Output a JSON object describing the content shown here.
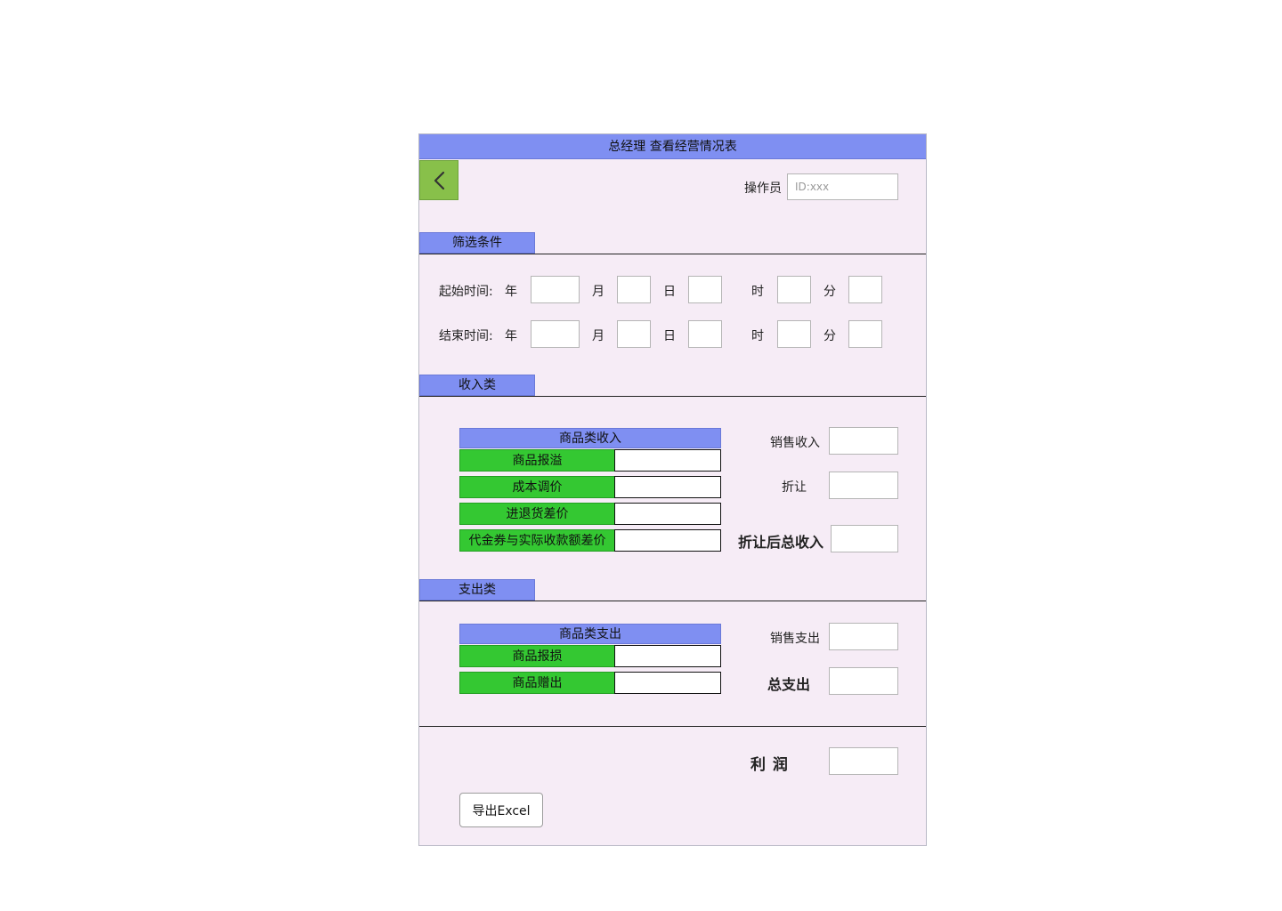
{
  "header": {
    "title": "总经理 查看经营情况表"
  },
  "operator": {
    "label": "操作员",
    "placeholder": "ID:xxx"
  },
  "filter": {
    "section_label": "筛选条件",
    "start_label": "起始时间:",
    "end_label": "结束时间:",
    "units": {
      "year": "年",
      "month": "月",
      "day": "日",
      "hour": "时",
      "minute": "分"
    }
  },
  "income": {
    "section_label": "收入类",
    "group_title": "商品类收入",
    "rows": [
      "商品报溢",
      "成本调价",
      "进退货差价",
      "代金券与实际收款额差价"
    ],
    "sales_income_label": "销售收入",
    "discount_label": "折让",
    "total_after_discount_label": "折让后总收入"
  },
  "expense": {
    "section_label": "支出类",
    "group_title": "商品类支出",
    "rows": [
      "商品报损",
      "商品赠出"
    ],
    "sales_expense_label": "销售支出",
    "total_expense_label": "总支出"
  },
  "profit": {
    "label": "利 润"
  },
  "actions": {
    "export_label": "导出Excel"
  },
  "colors": {
    "accent": "#7f8ff2",
    "green": "#34c832",
    "back": "#88c04a",
    "panel": "#f6ecf6"
  },
  "icons": {
    "back": "chevron-left-icon"
  }
}
